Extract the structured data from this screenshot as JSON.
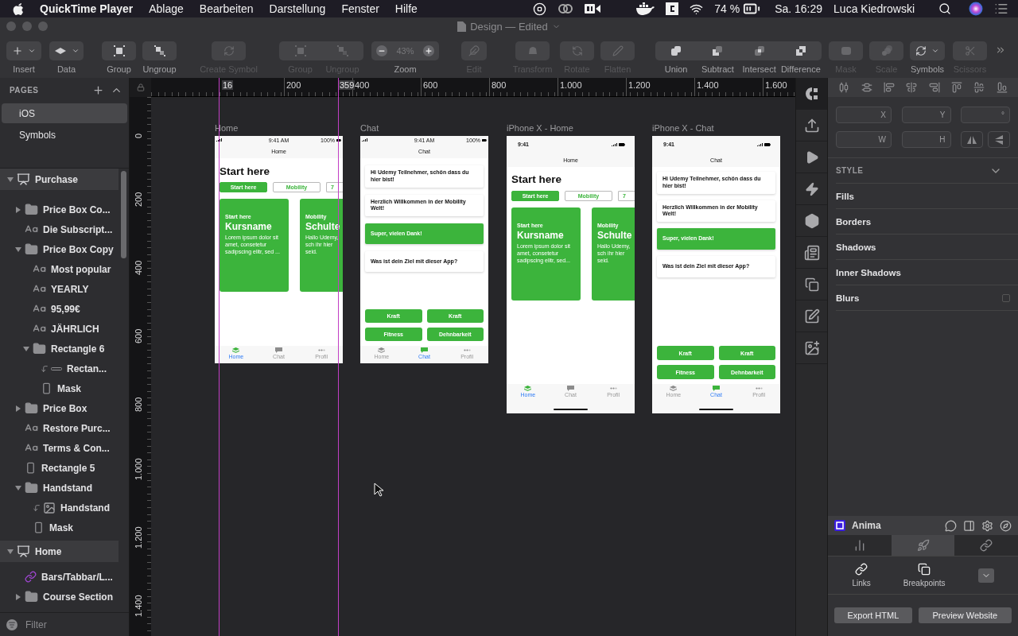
{
  "menubar": {
    "app": "QuickTime Player",
    "menus": [
      "Ablage",
      "Bearbeiten",
      "Darstellung",
      "Fenster",
      "Hilfe"
    ],
    "battery": "74 %",
    "clock": "Sa. 16:29",
    "user": "Luca Kiedrowski"
  },
  "window": {
    "title": "Design — Edited"
  },
  "toolbar": [
    {
      "kind": "single",
      "items": [
        {
          "label": "Insert",
          "disabled": false,
          "menu": true
        }
      ]
    },
    {
      "kind": "single",
      "items": [
        {
          "label": "Data",
          "disabled": false,
          "menu": true
        }
      ]
    },
    {
      "kind": "single",
      "items": [
        {
          "label": "Group",
          "disabled": false,
          "menu": false
        }
      ]
    },
    {
      "kind": "single",
      "items": [
        {
          "label": "Ungroup",
          "disabled": false,
          "menu": false
        }
      ]
    },
    {
      "kind": "single",
      "items": [
        {
          "label": "Create Symbol",
          "disabled": true,
          "menu": false
        }
      ]
    },
    {
      "kind": "segmented",
      "items": [
        {
          "label": "Group",
          "disabled": true,
          "menu": false
        },
        {
          "label": "Ungroup",
          "disabled": true,
          "menu": false
        }
      ]
    },
    {
      "kind": "zoom",
      "label": "Zoom",
      "value": "43%"
    },
    {
      "kind": "single",
      "items": [
        {
          "label": "Edit",
          "disabled": true,
          "menu": false
        }
      ]
    },
    {
      "kind": "single",
      "items": [
        {
          "label": "Transform",
          "disabled": true,
          "menu": false
        }
      ]
    },
    {
      "kind": "single",
      "items": [
        {
          "label": "Rotate",
          "disabled": true,
          "menu": false
        }
      ]
    },
    {
      "kind": "single",
      "items": [
        {
          "label": "Flatten",
          "disabled": true,
          "menu": false
        }
      ]
    },
    {
      "kind": "segmented",
      "items": [
        {
          "label": "Union",
          "disabled": false,
          "menu": false
        },
        {
          "label": "Subtract",
          "disabled": false,
          "menu": false
        },
        {
          "label": "Intersect",
          "disabled": false,
          "menu": false
        },
        {
          "label": "Difference",
          "disabled": false,
          "menu": false
        }
      ]
    },
    {
      "kind": "single",
      "items": [
        {
          "label": "Mask",
          "disabled": true,
          "menu": false
        }
      ]
    },
    {
      "kind": "single",
      "items": [
        {
          "label": "Scale",
          "disabled": true,
          "menu": false
        }
      ]
    },
    {
      "kind": "single",
      "items": [
        {
          "label": "Symbols",
          "disabled": false,
          "menu": true
        }
      ]
    },
    {
      "kind": "single",
      "items": [
        {
          "label": "Scissors",
          "disabled": true,
          "menu": false
        }
      ]
    }
  ],
  "pages": {
    "title": "PAGES",
    "items": [
      {
        "label": "iOS",
        "selected": true
      },
      {
        "label": "Symbols",
        "selected": false
      }
    ]
  },
  "layers": [
    {
      "name": "Purchase",
      "kind": "artboard",
      "masked": false,
      "expanded": true,
      "children": [
        {
          "name": "Price Box Co...",
          "kind": "group",
          "masked": false,
          "expanded": false
        },
        {
          "name": "Die Subscript...",
          "kind": "text",
          "masked": false
        },
        {
          "name": "Price Box Copy",
          "kind": "group",
          "masked": false,
          "expanded": true,
          "children": [
            {
              "name": "Most popular",
              "kind": "text",
              "masked": false
            },
            {
              "name": "YEARLY",
              "kind": "text",
              "masked": false
            },
            {
              "name": "95,99€",
              "kind": "text",
              "masked": false
            },
            {
              "name": "JÄHRLICH",
              "kind": "text",
              "masked": false
            },
            {
              "name": "Rectangle 6",
              "kind": "group",
              "masked": false,
              "expanded": true,
              "children": [
                {
                  "name": "Rectan...",
                  "kind": "line",
                  "masked": true
                },
                {
                  "name": "Mask",
                  "kind": "shape",
                  "masked": false
                }
              ]
            }
          ]
        },
        {
          "name": "Price Box",
          "kind": "group",
          "masked": false,
          "expanded": false
        },
        {
          "name": "Restore Purc...",
          "kind": "text",
          "masked": false
        },
        {
          "name": "Terms & Con...",
          "kind": "text",
          "masked": false
        },
        {
          "name": "Rectangle 5",
          "kind": "shape",
          "masked": false
        },
        {
          "name": "Handstand",
          "kind": "group",
          "masked": false,
          "expanded": true,
          "children": [
            {
              "name": "Handstand",
              "kind": "image",
              "masked": true
            },
            {
              "name": "Mask",
              "kind": "shape",
              "masked": false
            }
          ]
        }
      ]
    },
    {
      "name": "Home",
      "kind": "artboard",
      "masked": false,
      "expanded": true,
      "children": [
        {
          "name": "Bars/Tabbar/L...",
          "kind": "symbol",
          "masked": false
        },
        {
          "name": "Course Section",
          "kind": "group",
          "masked": false,
          "expanded": false
        }
      ]
    }
  ],
  "filter": {
    "placeholder": "Filter"
  },
  "ruler": {
    "x_labels": [
      "200",
      "400",
      "600",
      "800",
      "1.000",
      "1.200",
      "1.400",
      "1.600"
    ],
    "y_labels": [
      "0",
      "200",
      "400",
      "600",
      "800",
      "1.000",
      "1.200",
      "1.400"
    ],
    "markers": [
      "16",
      "359"
    ]
  },
  "artboards": [
    {
      "title": "Home",
      "kind": "home",
      "status_bar": {
        "kind": "classic",
        "time": "9:41 AM",
        "battery": "100%"
      },
      "nav_title": "Home",
      "heading": "Start here",
      "chips": [
        {
          "label": "Start here",
          "selected": true
        },
        {
          "label": "Mobility",
          "selected": false
        },
        {
          "label": "7",
          "selected": false
        }
      ],
      "cards": [
        {
          "eyebrow": "Start here",
          "title": "Kursname",
          "body": "Lorem ipsum dolor sit amet, consetetur sadipscing elitr, sed ..."
        },
        {
          "eyebrow": "Mobility",
          "title": "Schulte",
          "body": "Hallo Udemy, sch ihr hier seid."
        }
      ],
      "tabs": [
        {
          "label": "Home",
          "selected": true
        },
        {
          "label": "Chat",
          "selected": false
        },
        {
          "label": "Profil",
          "selected": false
        }
      ]
    },
    {
      "title": "Chat",
      "kind": "chat",
      "status_bar": {
        "kind": "classic",
        "time": "9:41 AM",
        "battery": "100%"
      },
      "nav_title": "Chat",
      "messages": [
        {
          "text": "Hi Udemy Teilnehmer, schön dass du hier bist!",
          "mine": false
        },
        {
          "text": "Herzlich Willkommen in der Mobility Welt!",
          "mine": false
        },
        {
          "text": "Super, vielen Dank!",
          "mine": true
        },
        {
          "text": "Was ist dein Ziel mit dieser App?",
          "mine": false
        }
      ],
      "options": [
        "Kraft",
        "Kraft",
        "Fitness",
        "Dehnbarkeit"
      ],
      "tabs": [
        {
          "label": "Home",
          "selected": false
        },
        {
          "label": "Chat",
          "selected": true
        },
        {
          "label": "Profil",
          "selected": false
        }
      ]
    },
    {
      "title": "iPhone X - Home",
      "kind": "home",
      "status_bar": {
        "kind": "notch",
        "time": "9:41"
      },
      "nav_title": "Home",
      "heading": "Start here",
      "chips": [
        {
          "label": "Start here",
          "selected": true
        },
        {
          "label": "Mobility",
          "selected": false
        },
        {
          "label": "7",
          "selected": false
        }
      ],
      "cards": [
        {
          "eyebrow": "Start here",
          "title": "Kursname",
          "body": "Lorem ipsum dolor sit amet, consetetur sadipscing elitr, sed..."
        },
        {
          "eyebrow": "Mobility",
          "title": "Schulte",
          "body": "Hallo Udemy, sch ihr hier seid."
        }
      ],
      "tabs": [
        {
          "label": "Home",
          "selected": true
        },
        {
          "label": "Chat",
          "selected": false
        },
        {
          "label": "Profil",
          "selected": false
        }
      ]
    },
    {
      "title": "iPhone X - Chat",
      "kind": "chat",
      "status_bar": {
        "kind": "notch",
        "time": "9:41"
      },
      "nav_title": "Chat",
      "messages": [
        {
          "text": "Hi Udemy Teilnehmer, schön dass du hier bist!",
          "mine": false
        },
        {
          "text": "Herzlich Willkommen in der Mobility Welt!",
          "mine": false
        },
        {
          "text": "Super, vielen Dank!",
          "mine": true
        },
        {
          "text": "Was ist dein Ziel mit dieser App?",
          "mine": false
        }
      ],
      "options": [
        "Kraft",
        "Kraft",
        "Fitness",
        "Dehnbarkeit"
      ],
      "tabs": [
        {
          "label": "Home",
          "selected": false
        },
        {
          "label": "Chat",
          "selected": true
        },
        {
          "label": "Profil",
          "selected": false
        }
      ]
    }
  ],
  "inspector": {
    "fields": [
      "X",
      "Y",
      "°",
      "W",
      "H"
    ],
    "style_title": "STYLE",
    "sections": [
      {
        "label": "Fills",
        "kind": "plain"
      },
      {
        "label": "Borders",
        "kind": "plain"
      },
      {
        "label": "Shadows",
        "kind": "plain"
      },
      {
        "label": "Inner Shadows",
        "kind": "plain"
      },
      {
        "label": "Blurs",
        "kind": "toggle",
        "checked": false
      }
    ]
  },
  "anima": {
    "title": "Anima",
    "tabs": [
      {
        "selected": false
      },
      {
        "selected": true
      },
      {
        "selected": false
      }
    ],
    "actions": [
      "Links",
      "Breakpoints"
    ],
    "buttons": [
      "Export HTML",
      "Preview Website"
    ]
  }
}
